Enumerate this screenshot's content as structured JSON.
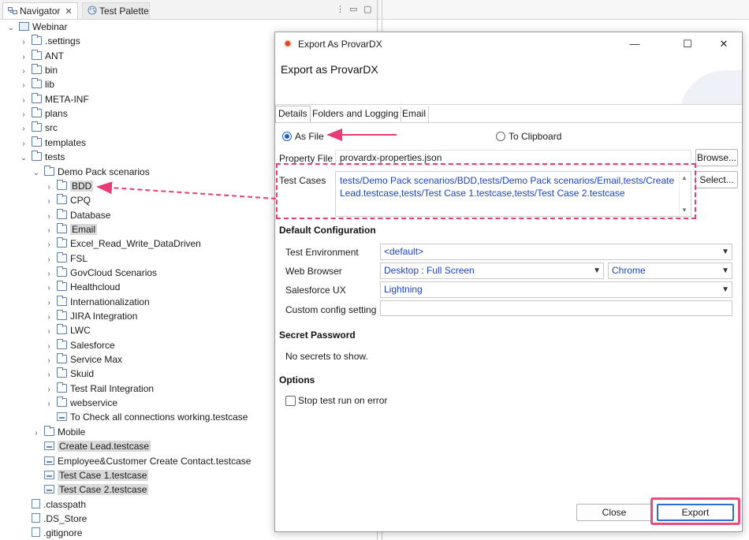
{
  "navigator": {
    "tabs": [
      {
        "label": "Navigator",
        "active": true,
        "icon": "navigator-icon"
      },
      {
        "label": "Test Palette",
        "active": false,
        "icon": "palette-icon"
      }
    ],
    "tree": [
      {
        "label": "Webinar",
        "depth": 0,
        "expanded": true,
        "type": "project",
        "selected": false
      },
      {
        "label": ".settings",
        "depth": 1,
        "expanded": false,
        "type": "folder",
        "selected": false
      },
      {
        "label": "ANT",
        "depth": 1,
        "expanded": false,
        "type": "folder",
        "selected": false
      },
      {
        "label": "bin",
        "depth": 1,
        "expanded": false,
        "type": "folder",
        "selected": false
      },
      {
        "label": "lib",
        "depth": 1,
        "expanded": false,
        "type": "folder",
        "selected": false
      },
      {
        "label": "META-INF",
        "depth": 1,
        "expanded": false,
        "type": "folder",
        "selected": false
      },
      {
        "label": "plans",
        "depth": 1,
        "expanded": false,
        "type": "folder",
        "selected": false
      },
      {
        "label": "src",
        "depth": 1,
        "expanded": false,
        "type": "folder",
        "selected": false
      },
      {
        "label": "templates",
        "depth": 1,
        "expanded": false,
        "type": "folder",
        "selected": false
      },
      {
        "label": "tests",
        "depth": 1,
        "expanded": true,
        "type": "folder",
        "selected": false
      },
      {
        "label": "Demo Pack scenarios",
        "depth": 2,
        "expanded": true,
        "type": "folder",
        "selected": false
      },
      {
        "label": "BDD",
        "depth": 3,
        "expanded": false,
        "type": "folder",
        "selected": true
      },
      {
        "label": "CPQ",
        "depth": 3,
        "expanded": false,
        "type": "folder",
        "selected": false
      },
      {
        "label": "Database",
        "depth": 3,
        "expanded": false,
        "type": "folder",
        "selected": false
      },
      {
        "label": "Email",
        "depth": 3,
        "expanded": false,
        "type": "folder",
        "selected": true
      },
      {
        "label": "Excel_Read_Write_DataDriven",
        "depth": 3,
        "expanded": false,
        "type": "folder",
        "selected": false
      },
      {
        "label": "FSL",
        "depth": 3,
        "expanded": false,
        "type": "folder",
        "selected": false
      },
      {
        "label": "GovCloud Scenarios",
        "depth": 3,
        "expanded": false,
        "type": "folder",
        "selected": false
      },
      {
        "label": "Healthcloud",
        "depth": 3,
        "expanded": false,
        "type": "folder",
        "selected": false
      },
      {
        "label": "Internationalization",
        "depth": 3,
        "expanded": false,
        "type": "folder",
        "selected": false
      },
      {
        "label": "JIRA Integration",
        "depth": 3,
        "expanded": false,
        "type": "folder",
        "selected": false
      },
      {
        "label": "LWC",
        "depth": 3,
        "expanded": false,
        "type": "folder",
        "selected": false
      },
      {
        "label": "Salesforce",
        "depth": 3,
        "expanded": false,
        "type": "folder",
        "selected": false
      },
      {
        "label": "Service Max",
        "depth": 3,
        "expanded": false,
        "type": "folder",
        "selected": false
      },
      {
        "label": "Skuid",
        "depth": 3,
        "expanded": false,
        "type": "folder",
        "selected": false
      },
      {
        "label": "Test Rail Integration",
        "depth": 3,
        "expanded": false,
        "type": "folder",
        "selected": false
      },
      {
        "label": "webservice",
        "depth": 3,
        "expanded": false,
        "type": "folder",
        "selected": false
      },
      {
        "label": "To Check all connections working.testcase",
        "depth": 3,
        "expanded": null,
        "type": "testcase",
        "selected": false
      },
      {
        "label": "Mobile",
        "depth": 2,
        "expanded": false,
        "type": "folder",
        "selected": false
      },
      {
        "label": "Create Lead.testcase",
        "depth": 2,
        "expanded": null,
        "type": "testcase",
        "selected": true
      },
      {
        "label": "Employee&Customer Create Contact.testcase",
        "depth": 2,
        "expanded": null,
        "type": "testcase",
        "selected": false
      },
      {
        "label": "Test Case 1.testcase",
        "depth": 2,
        "expanded": null,
        "type": "testcase",
        "selected": true
      },
      {
        "label": "Test Case 2.testcase",
        "depth": 2,
        "expanded": null,
        "type": "testcase",
        "selected": true
      },
      {
        "label": ".classpath",
        "depth": 1,
        "expanded": null,
        "type": "file",
        "selected": false
      },
      {
        "label": ".DS_Store",
        "depth": 1,
        "expanded": null,
        "type": "file",
        "selected": false
      },
      {
        "label": ".gitignore",
        "depth": 1,
        "expanded": null,
        "type": "file",
        "selected": false
      }
    ]
  },
  "dialog": {
    "window_title": "Export As ProvarDX",
    "heading": "Export as ProvarDX",
    "tabs": [
      "Details",
      "Folders and Logging",
      "Email"
    ],
    "output_as_file": "As File",
    "output_to_clipboard": "To Clipboard",
    "selected_output": "As File",
    "property_file_label": "Property File",
    "property_file_value": "provardx-properties.json",
    "browse_label": "Browse...",
    "test_cases_label": "Test Cases",
    "test_cases_value": "tests/Demo Pack scenarios/BDD,tests/Demo Pack scenarios/Email,tests/Create Lead.testcase,tests/Test Case 1.testcase,tests/Test Case 2.testcase",
    "select_label": "Select...",
    "default_config_title": "Default Configuration",
    "test_environment_label": "Test Environment",
    "test_environment_value": "<default>",
    "web_browser_label": "Web Browser",
    "web_browser_resolution": "Desktop : Full Screen",
    "web_browser_value": "Chrome",
    "salesforce_ux_label": "Salesforce UX",
    "salesforce_ux_value": "Lightning",
    "custom_config_label": "Custom config setting",
    "custom_config_value": "",
    "secret_password_title": "Secret Password",
    "no_secrets_text": "No secrets to show.",
    "options_title": "Options",
    "stop_on_error_label": "Stop test run on error",
    "stop_on_error_checked": false,
    "close_label": "Close",
    "export_label": "Export"
  },
  "colors": {
    "annotation": "#e63c78",
    "link_text": "#1b43c9",
    "selection": "#d9d9d9",
    "accent": "#2b6fd6"
  }
}
